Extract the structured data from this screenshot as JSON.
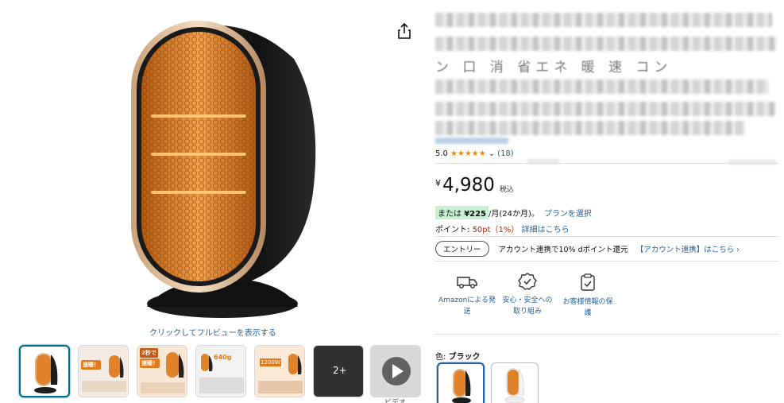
{
  "gallery": {
    "fullview_label": "クリックしてフルビューを表示する",
    "thumb_texts": {
      "t2_badge": "速暖！",
      "t3_top": "2秒で",
      "t3_badge": "速暖！",
      "t4_val": "640g",
      "t5_val": "1200W",
      "t6_badge": "2+"
    },
    "video_label": "ビデオ"
  },
  "title": {
    "visible_fragment": "ン 口 消 省エネ 暖 速 コン"
  },
  "rating": {
    "score": "5.0",
    "stars": "★★★★★",
    "count": "(18)"
  },
  "price": {
    "currency": "¥",
    "value": "4,980",
    "tax_label": "税込"
  },
  "installment": {
    "or_label": "または",
    "amount": "¥225",
    "term": "/月(24か月)。",
    "plan_link": "プランを選択"
  },
  "points": {
    "label": "ポイント: ",
    "value": "50pt（1%）",
    "details_link": "詳細はこちら"
  },
  "entry": {
    "button_label": "エントリー",
    "text": "アカウント連携で10% dポイント還元",
    "link": "【アカウント連携】はこちら ›"
  },
  "features": [
    {
      "line1": "Amazonによる発",
      "line2": "送"
    },
    {
      "line1": "安心・安全への",
      "line2": "取り組み"
    },
    {
      "line1": "お客様情報の保",
      "line2": "護"
    }
  ],
  "color": {
    "label": "色: ",
    "selected": "ブラック"
  },
  "colors": {
    "accent_link": "#2162a1",
    "star": "#f08804",
    "point": "#b12704",
    "installment_bg": "#c8f0d3",
    "heater_body": "#1c1c1c",
    "heater_grille": "#e0822a"
  }
}
